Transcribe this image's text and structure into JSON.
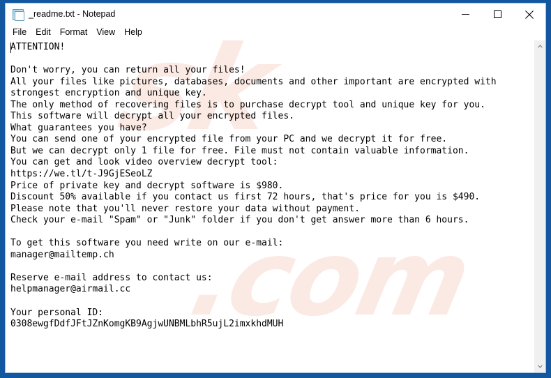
{
  "window": {
    "title": "_readme.txt - Notepad",
    "icon": "notepad-icon",
    "frame_color": "#1257a0",
    "controls": {
      "minimize_label": "Minimize",
      "maximize_label": "Maximize",
      "close_label": "Close"
    }
  },
  "menu": {
    "items": [
      {
        "label": "File"
      },
      {
        "label": "Edit"
      },
      {
        "label": "Format"
      },
      {
        "label": "View"
      },
      {
        "label": "Help"
      }
    ]
  },
  "editor": {
    "content": "ATTENTION!\n\nDon't worry, you can return all your files!\nAll your files like pictures, databases, documents and other important are encrypted with\nstrongest encryption and unique key.\nThe only method of recovering files is to purchase decrypt tool and unique key for you.\nThis software will decrypt all your encrypted files.\nWhat guarantees you have?\nYou can send one of your encrypted file from your PC and we decrypt it for free.\nBut we can decrypt only 1 file for free. File must not contain valuable information.\nYou can get and look video overview decrypt tool:\nhttps://we.tl/t-J9GjESeoLZ\nPrice of private key and decrypt software is $980.\nDiscount 50% available if you contact us first 72 hours, that's price for you is $490.\nPlease note that you'll never restore your data without payment.\nCheck your e-mail \"Spam\" or \"Junk\" folder if you don't get answer more than 6 hours.\n\nTo get this software you need write on our e-mail:\nmanager@mailtemp.ch\n\nReserve e-mail address to contact us:\nhelpmanager@airmail.cc\n\nYour personal ID:\n0308ewgfDdfJFtJZnKomgKB9AgjwUNBMLbhR5ujL2imxkhdMUH",
    "lines": [
      "ATTENTION!",
      "",
      "Don't worry, you can return all your files!",
      "All your files like pictures, databases, documents and other important are encrypted with",
      "strongest encryption and unique key.",
      "The only method of recovering files is to purchase decrypt tool and unique key for you.",
      "This software will decrypt all your encrypted files.",
      "What guarantees you have?",
      "You can send one of your encrypted file from your PC and we decrypt it for free.",
      "But we can decrypt only 1 file for free. File must not contain valuable information.",
      "You can get and look video overview decrypt tool:",
      "https://we.tl/t-J9GjESeoLZ",
      "Price of private key and decrypt software is $980.",
      "Discount 50% available if you contact us first 72 hours, that's price for you is $490.",
      "Please note that you'll never restore your data without payment.",
      "Check your e-mail \"Spam\" or \"Junk\" folder if you don't get answer more than 6 hours.",
      "",
      "To get this software you need write on our e-mail:",
      "manager@mailtemp.ch",
      "",
      "Reserve e-mail address to contact us:",
      "helpmanager@airmail.cc",
      "",
      "Your personal ID:",
      "0308ewgfDdfJFtJZnKomgKB9AgjwUNBMLbhR5ujL2imxkhdMUH"
    ],
    "details": {
      "video_url": "https://we.tl/t-J9GjESeoLZ",
      "price_full": "$980",
      "price_discount": "$490",
      "discount_percent": "50%",
      "discount_window_hours": "72 hours",
      "answer_window_hours": "6 hours",
      "free_files": "1 file",
      "primary_email": "manager@mailtemp.ch",
      "reserve_email": "helpmanager@airmail.cc",
      "personal_id": "0308ewgfDdfJFtJZnKomgKB9AgjwUNBMLbhR5ujL2imxkhdMUH"
    }
  },
  "watermark": {
    "line1": "sk",
    "line2": ".com"
  },
  "scrollbar": {
    "up_arrow": "▲",
    "down_arrow": "▼"
  }
}
